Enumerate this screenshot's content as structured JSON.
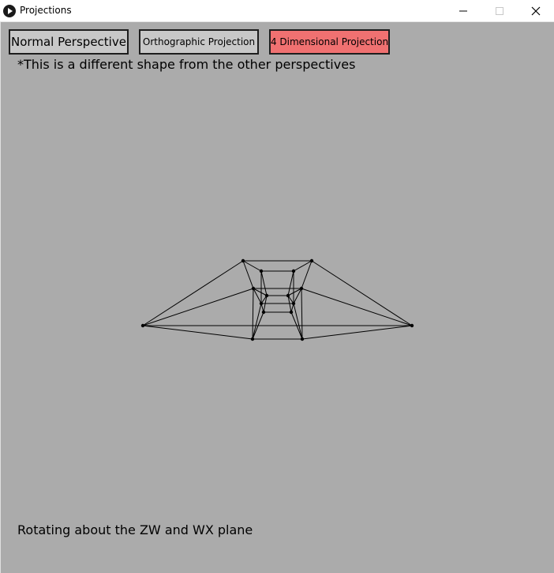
{
  "window": {
    "title": "Projections",
    "icon": "play-icon",
    "controls": [
      "minimize-icon",
      "maximize-icon",
      "close-icon"
    ]
  },
  "toolbar": {
    "buttons": [
      {
        "label": "Normal Perspective",
        "active": false
      },
      {
        "label": "Orthographic Projection",
        "active": false
      },
      {
        "label": "4 Dimensional Projection",
        "active": true
      }
    ]
  },
  "note": "*This is a different shape from the other perspectives",
  "status": "Rotating about the ZW and WX plane",
  "colors": {
    "background": "#ababab",
    "button": "#c8c8c8",
    "active_button": "#f07171",
    "edge": "#000000"
  }
}
